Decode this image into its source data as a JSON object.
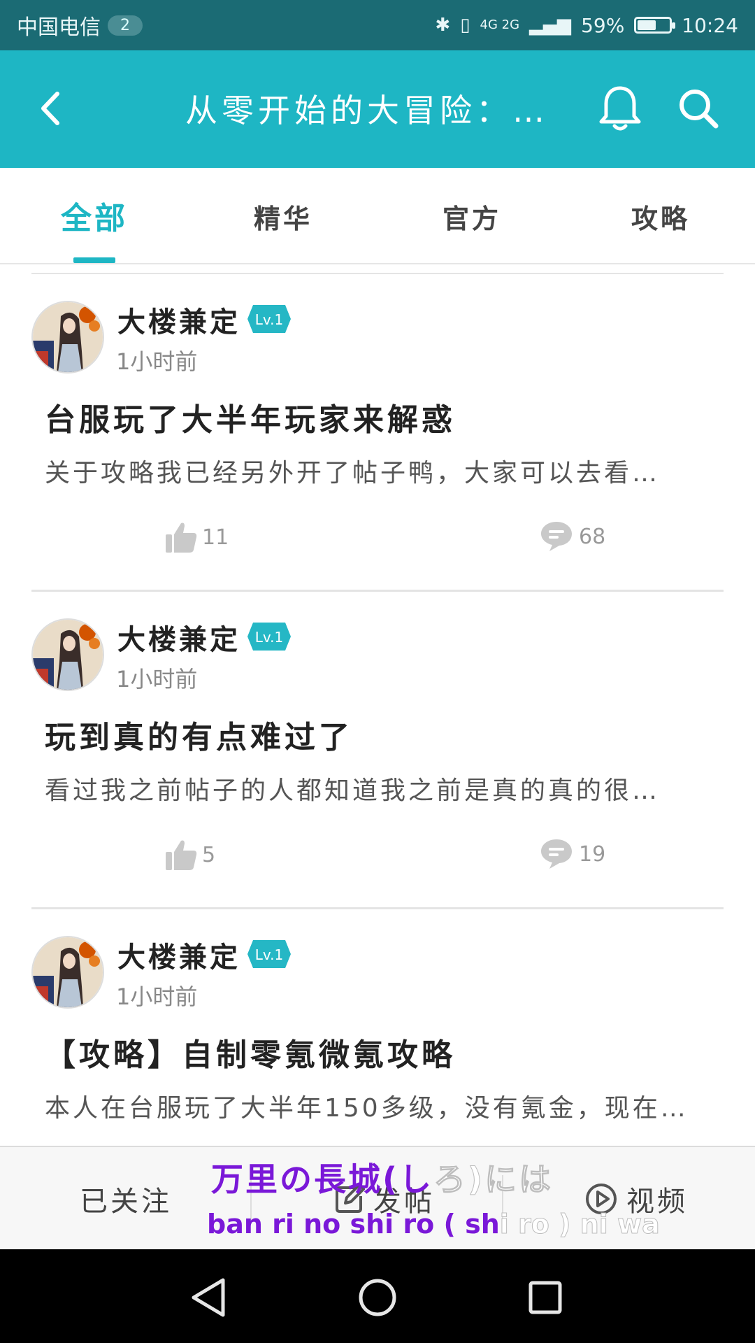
{
  "status_bar": {
    "carrier": "中国电信",
    "sim_badge": "2",
    "network": "4G 2G",
    "battery_percent": "59%",
    "battery_level": 0.59,
    "time": "10:24"
  },
  "header": {
    "title": "从零开始的大冒险：…"
  },
  "tabs": [
    {
      "label": "全部",
      "active": true
    },
    {
      "label": "精华",
      "active": false
    },
    {
      "label": "官方",
      "active": false
    },
    {
      "label": "攻略",
      "active": false
    }
  ],
  "posts": [
    {
      "author": "大楼兼定",
      "level": "Lv.1",
      "time": "1小时前",
      "title": "台服玩了大半年玩家来解惑",
      "excerpt": "关于攻略我已经另外开了帖子鸭，大家可以去看…",
      "likes": "11",
      "comments": "68"
    },
    {
      "author": "大楼兼定",
      "level": "Lv.1",
      "time": "1小时前",
      "title": "玩到真的有点难过了",
      "excerpt": "看过我之前帖子的人都知道我之前是真的真的很…",
      "likes": "5",
      "comments": "19"
    },
    {
      "author": "大楼兼定",
      "level": "Lv.1",
      "time": "1小时前",
      "title": "【攻略】自制零氪微氪攻略",
      "excerpt": "本人在台服玩了大半年150多级，没有氪金，现在…",
      "likes": "",
      "comments": ""
    }
  ],
  "bottom_bar": {
    "followed": "已关注",
    "post": "发帖",
    "video": "视频"
  },
  "lyrics": {
    "line1_main": "万里の長城(し",
    "line1_fade": "ろ)には",
    "line2_main": "ban ri no shi ro ( sh",
    "line2_fade": "i ro ) ni wa"
  },
  "colors": {
    "accent": "#1eb6c4",
    "status_bar": "#1b6b74",
    "lyric": "#7a18d8"
  }
}
